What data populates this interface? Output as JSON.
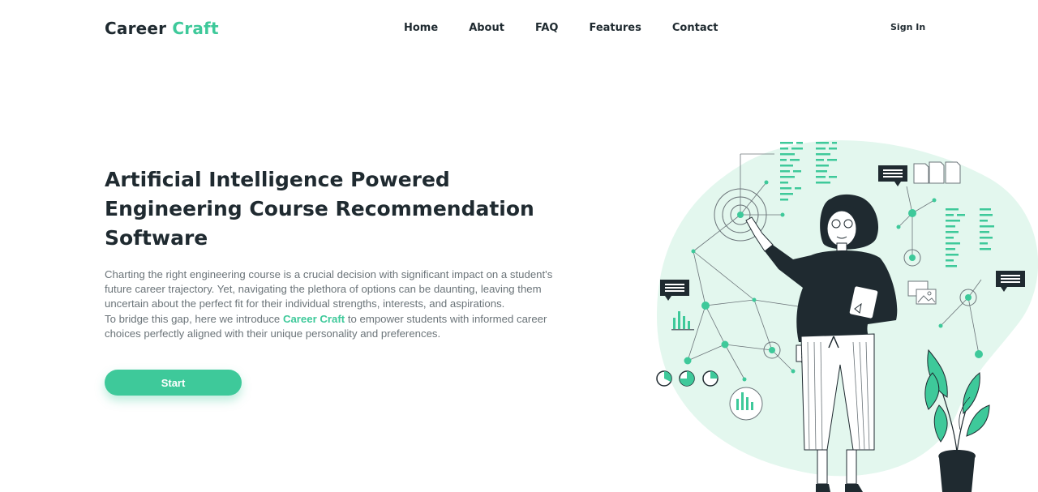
{
  "header": {
    "logo_part1": "Career",
    "logo_part2": "Craft",
    "nav": [
      {
        "label": "Home"
      },
      {
        "label": "About"
      },
      {
        "label": "FAQ"
      },
      {
        "label": "Features"
      },
      {
        "label": "Contact"
      }
    ],
    "signin_label": "Sign In"
  },
  "hero": {
    "title_line1": "Artificial Intelligence Powered",
    "title_line2": "Engineering Course Recommendation",
    "title_line3": "Software",
    "para1": "Charting the right engineering course is a crucial decision with significant impact on a student's future career trajectory. Yet, navigating the plethora of options can be daunting, leaving them uncertain about the perfect fit for their individual strengths, interests, and aspirations.",
    "para2_before": "To bridge this gap, here we introduce ",
    "para2_brand": "Career Craft",
    "para2_after": " to empower students with informed career choices perfectly aligned with their unique personality and preferences.",
    "start_label": "Start"
  },
  "colors": {
    "accent": "#3ec99a",
    "blob": "#e3f7ee",
    "dark": "#1f2a30",
    "text_muted": "#6b7479"
  },
  "illustration": {
    "icons": [
      "woman-with-tablet",
      "network-graph",
      "chat-bubble-icon",
      "document-icon",
      "bar-chart-icon",
      "image-icon",
      "plant-icon",
      "pie-chart-icon"
    ]
  }
}
